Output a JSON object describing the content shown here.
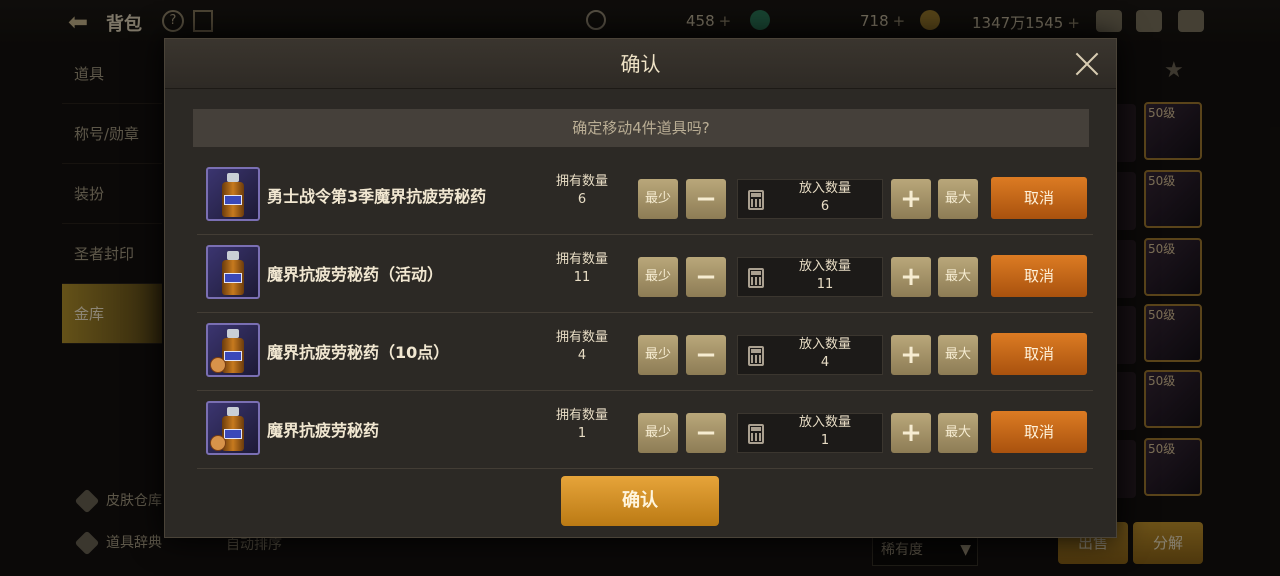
{
  "header": {
    "back_icon": "back-arrow-icon",
    "title": "背包",
    "currencies": [
      {
        "icon": "coin-c-icon",
        "value": "458"
      },
      {
        "icon": "green-gem-icon",
        "value": "718"
      },
      {
        "icon": "gold-coin-icon",
        "value": "1347万1545"
      }
    ],
    "plus": "+"
  },
  "sidebar": {
    "items": [
      {
        "label": "道具"
      },
      {
        "label": "称号/勋章"
      },
      {
        "label": "装扮"
      },
      {
        "label": "圣者封印"
      },
      {
        "label": "金库"
      }
    ],
    "active_index": 4,
    "bottom": [
      {
        "label": "皮肤仓库",
        "icon": "skin-storage-icon"
      },
      {
        "label": "道具辞典",
        "icon": "item-dictionary-icon"
      }
    ]
  },
  "footer": {
    "auto_sort": "自动排序",
    "rarity_select": "稀有度",
    "sell": "出售",
    "disassemble": "分解"
  },
  "inventory_slots": [
    "50级",
    "50级",
    "50级",
    "50级",
    "50级",
    "50级"
  ],
  "modal": {
    "title": "确认",
    "prompt": "确定移动4件道具吗?",
    "owned_label": "拥有数量",
    "put_label": "放入数量",
    "min_label": "最少",
    "max_label": "最大",
    "minus": "−",
    "plus": "+",
    "cancel_label": "取消",
    "confirm_label": "确认",
    "items": [
      {
        "name": "勇士战令第3季魔界抗疲劳秘药",
        "owned": "6",
        "put": "6"
      },
      {
        "name": "魔界抗疲劳秘药（活动）",
        "owned": "11",
        "put": "11"
      },
      {
        "name": "魔界抗疲劳秘药（10点）",
        "owned": "4",
        "put": "4"
      },
      {
        "name": "魔界抗疲劳秘药",
        "owned": "1",
        "put": "1"
      }
    ]
  },
  "colors": {
    "accent_gold": "#b9a77a",
    "cancel_orange": "#dc7b23",
    "confirm_gold": "#e6a43a",
    "item_border": "#7a6fb3"
  }
}
